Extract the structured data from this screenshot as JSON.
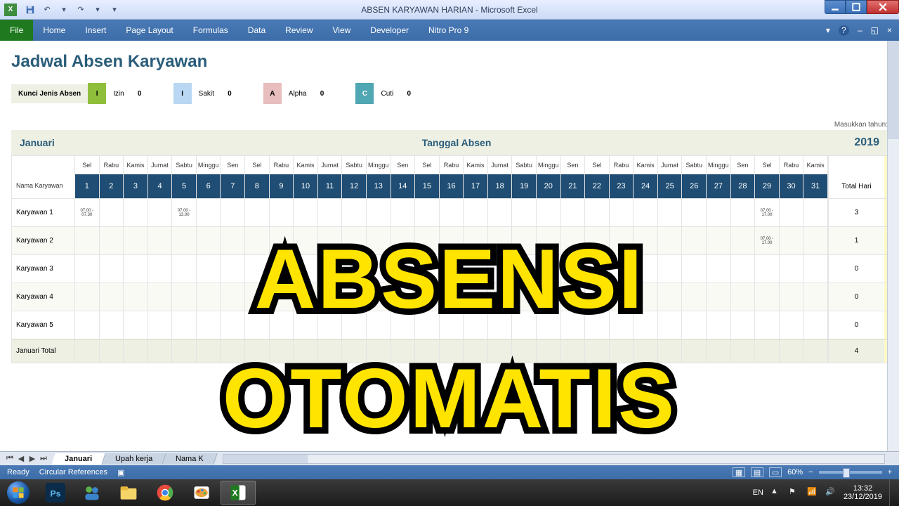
{
  "title": "ABSEN KARYAWAN HARIAN - Microsoft Excel",
  "ribbon": {
    "file": "File",
    "tabs": [
      "Home",
      "Insert",
      "Page Layout",
      "Formulas",
      "Data",
      "Review",
      "View",
      "Developer",
      "Nitro Pro 9"
    ]
  },
  "sheet": {
    "title": "Jadwal Absen Karyawan",
    "legendLabel": "Kunci Jenis Absen",
    "legend": [
      {
        "code": "I",
        "name": "Izin",
        "val": "0",
        "cls": "c-izin"
      },
      {
        "code": "I",
        "name": "Sakit",
        "val": "0",
        "cls": "c-sakit"
      },
      {
        "code": "A",
        "name": "Alpha",
        "val": "0",
        "cls": "c-alpha"
      },
      {
        "code": "C",
        "name": "Cuti",
        "val": "0",
        "cls": "c-cuti"
      }
    ],
    "yearHint": "Masukkan tahun:",
    "month": "Januari",
    "centerTitle": "Tanggal Absen",
    "year": "2019",
    "nameHdr": "Nama Karyawan",
    "totalHdr": "Total Hari",
    "dayNames": [
      "Sel",
      "Rabu",
      "Kamis",
      "Jumat",
      "Sabtu",
      "Minggu",
      "Sen",
      "Sel",
      "Rabu",
      "Kamis",
      "Jumat",
      "Sabtu",
      "Minggu",
      "Sen",
      "Sel",
      "Rabu",
      "Kamis",
      "Jumat",
      "Sabtu",
      "Minggu",
      "Sen",
      "Sel",
      "Rabu",
      "Kamis",
      "Jumat",
      "Sabtu",
      "Minggu",
      "Sen",
      "Sel",
      "Rabu",
      "Kamis"
    ],
    "dayNums": [
      "1",
      "2",
      "3",
      "4",
      "5",
      "6",
      "7",
      "8",
      "9",
      "10",
      "11",
      "12",
      "13",
      "14",
      "15",
      "16",
      "17",
      "18",
      "19",
      "20",
      "21",
      "22",
      "23",
      "24",
      "25",
      "26",
      "27",
      "28",
      "29",
      "30",
      "31"
    ],
    "rows": [
      {
        "name": "Karyawan 1",
        "cells": {
          "0": "07.00 - 07.30",
          "4": "07.00 - 13.00",
          "28": "07.00 - 17.00"
        },
        "total": "3"
      },
      {
        "name": "Karyawan 2",
        "cells": {
          "28": "07.00 - 17.00"
        },
        "total": "1"
      },
      {
        "name": "Karyawan 3",
        "cells": {},
        "total": "0"
      },
      {
        "name": "Karyawan 4",
        "cells": {},
        "total": "0"
      },
      {
        "name": "Karyawan 5",
        "cells": {},
        "total": "0"
      }
    ],
    "totalRowLabel": "Januari Total",
    "grandTotal": "4"
  },
  "sheetTabs": {
    "active": "Januari",
    "others": [
      "Upah kerja",
      "Nama K"
    ]
  },
  "statusbar": {
    "ready": "Ready",
    "circ": "Circular References",
    "zoom": "60%"
  },
  "taskbar": {
    "lang": "EN",
    "time": "13:32",
    "date": "23/12/2019"
  },
  "overlay": {
    "line1": "ABSENSI",
    "line2": "OTOMATIS"
  }
}
